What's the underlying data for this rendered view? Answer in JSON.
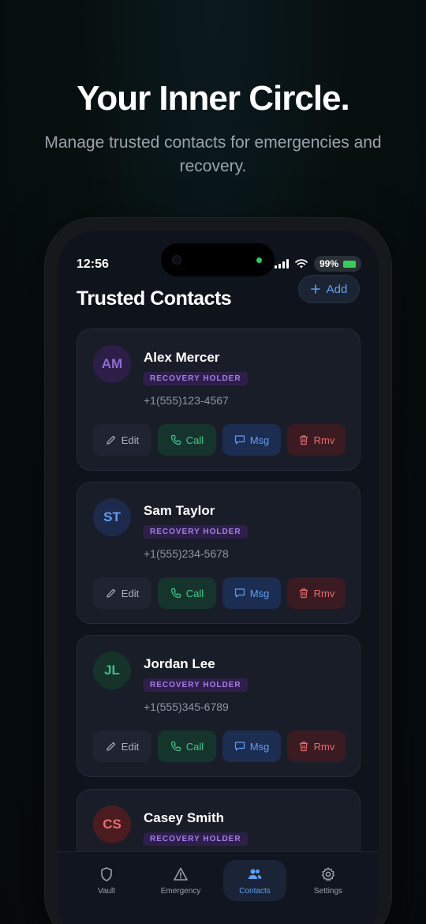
{
  "hero": {
    "title": "Your Inner Circle.",
    "subtitle": "Manage trusted contacts for emergencies and recovery."
  },
  "status_bar": {
    "time": "12:56",
    "battery": "99%"
  },
  "screen": {
    "title": "Trusted Contacts",
    "add_label": "Add"
  },
  "contacts": [
    {
      "initials": "AM",
      "name": "Alex Mercer",
      "role": "RECOVERY HOLDER",
      "phone": "+1(555)123-4567",
      "avatar_bg": "#2d1e48",
      "avatar_fg": "#8f6bd6"
    },
    {
      "initials": "ST",
      "name": "Sam Taylor",
      "role": "RECOVERY HOLDER",
      "phone": "+1(555)234-5678",
      "avatar_bg": "#1d2a4c",
      "avatar_fg": "#5f9ff0"
    },
    {
      "initials": "JL",
      "name": "Jordan Lee",
      "role": "RECOVERY HOLDER",
      "phone": "+1(555)345-6789",
      "avatar_bg": "#153329",
      "avatar_fg": "#3fbf86"
    },
    {
      "initials": "CS",
      "name": "Casey Smith",
      "role": "RECOVERY HOLDER",
      "phone": "",
      "avatar_bg": "#4a1c20",
      "avatar_fg": "#f06b6b"
    }
  ],
  "actions": {
    "edit": "Edit",
    "call": "Call",
    "msg": "Msg",
    "remove": "Rmv"
  },
  "tabs": [
    {
      "label": "Vault",
      "icon": "shield-icon"
    },
    {
      "label": "Emergency",
      "icon": "warning-icon"
    },
    {
      "label": "Contacts",
      "icon": "users-icon"
    },
    {
      "label": "Settings",
      "icon": "gear-icon"
    }
  ],
  "colors": {
    "accent": "#5aa2f5",
    "call": "#3fc98a",
    "remove": "#e56b6b",
    "badge": "#a37ee8"
  }
}
